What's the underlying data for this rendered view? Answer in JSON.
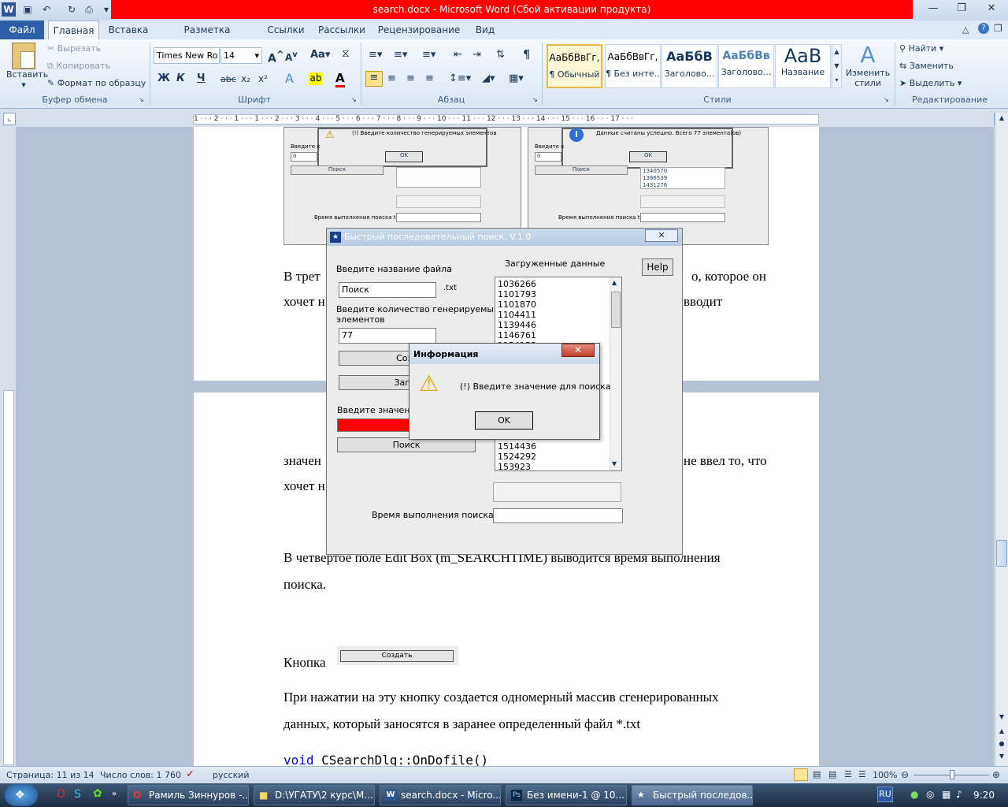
{
  "window": {
    "title": "search.docx - Microsoft Word (Сбой активации продукта)"
  },
  "tabs": [
    "Файл",
    "Главная",
    "Вставка",
    "Разметка страницы",
    "Ссылки",
    "Рассылки",
    "Рецензирование",
    "Вид"
  ],
  "ribbon": {
    "clipboard": {
      "paste": "Вставить",
      "cut": "Вырезать",
      "copy": "Копировать",
      "format_painter": "Формат по образцу",
      "label": "Буфер обмена"
    },
    "font": {
      "name": "Times New Ro",
      "size": "14",
      "bold": "Ж",
      "italic": "К",
      "underline": "Ч",
      "strike": "abc",
      "sub": "x₂",
      "sup": "x²",
      "label": "Шрифт",
      "grow": "A",
      "shrink": "A",
      "case": "Aa"
    },
    "paragraph": {
      "label": "Абзац"
    },
    "styles": {
      "items": [
        {
          "sample": "АаБбВвГг,",
          "name": "¶ Обычный"
        },
        {
          "sample": "АаБбВвГг,",
          "name": "¶ Без инте..."
        },
        {
          "sample": "АаБбВ",
          "name": "Заголово..."
        },
        {
          "sample": "АаБбВв",
          "name": "Заголово..."
        },
        {
          "sample": "АаВ",
          "name": "Название"
        }
      ],
      "change": "Изменить стили",
      "label": "Стили"
    },
    "editing": {
      "find": "Найти",
      "replace": "Заменить",
      "select": "Выделить",
      "label": "Редактирование"
    }
  },
  "ruler_text": "1 · · · 2 · · · 1 · · · 1 · · · 2 · · · 3 · · · 4 · · · 5 · · · 6 · · · 7 · · · 8 · · · 9 · · · 10 · · · 11 · · · 12 · · · 13 · · · 14 · · · 15 · · · 16 · · · 17 · · ·",
  "doc": {
    "para1a": "В трет",
    "para1b": "о, которое он",
    "para1c": "хочет н",
    "para1d": "вводит",
    "para2a": "значен",
    "para2b": "не ввел то, что",
    "para2c": "хочет н",
    "para3": "В четвертое поле Edit Box (m_SEARCHTIME) выводится время выполнения",
    "para3b": "поиска.",
    "button_line": "Кнопка",
    "button_img": "Создать",
    "para4": "При нажатии на эту кнопку создается одномерный массив сгенерированных",
    "para4b": "данных, который заносятся в заранее определенный файл *.txt",
    "code_kw": "void",
    "code_rest": " CSearchDlg::OnDofile()",
    "thumb1": {
      "msg": "(!) Введите количество генерируемых элементов",
      "ok": "OK",
      "enter": "Введите к",
      "value": "0",
      "search": "Поиск",
      "time": "Время выполнения поиска t"
    },
    "thumb2": {
      "msg": "Данные считаны успешно. Всего 77 элемента(ов)",
      "ok": "OK",
      "enter": "Введите к",
      "value": "0",
      "search": "Поиск",
      "list": [
        "1340570",
        "1386539",
        "1431276"
      ],
      "time": "Время выполнения поиска t"
    }
  },
  "app_dialog": {
    "title": "Быстрый последовательный поиск. V.1.0",
    "filename_label": "Введите название файла",
    "filename_value": "Поиск",
    "ext": ".txt",
    "count_label1": "Введите количество генерируемых",
    "count_label2": "элементов",
    "count_value": "77",
    "create": "Созд",
    "load": "Загру",
    "value_label": "Введите значение",
    "search": "Поиск",
    "loaded_label": "Загруженные данные",
    "help": "Help",
    "list": [
      "1036266",
      "1101793",
      "1101870",
      "1104411",
      "1139446",
      "1146761",
      "1154153"
    ],
    "list_bottom": [
      "1514436",
      "1524292",
      "153923"
    ],
    "time_label": "Время выполнения поиска t"
  },
  "info_dialog": {
    "title": "Информация",
    "message": "(!) Введите значение для поиска",
    "ok": "OK"
  },
  "statusbar": {
    "page": "Страница: 11 из 14",
    "words": "Число слов: 1 760",
    "lang": "русский",
    "zoom": "100%"
  },
  "taskbar": {
    "items": [
      "Рамиль Зиннуров -...",
      "D:\\УГАТУ\\2 курс\\М...",
      "search.docx - Micro...",
      "Без имени-1 @ 10...",
      "Быстрый последов..."
    ],
    "lang": "RU",
    "time": "9:20"
  }
}
